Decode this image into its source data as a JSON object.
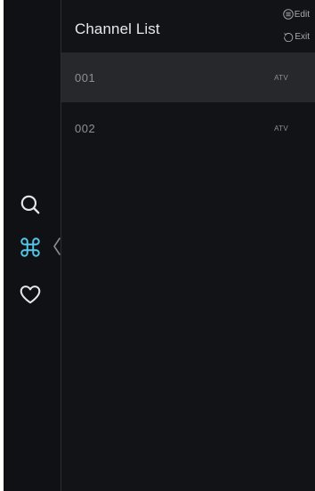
{
  "header": {
    "title": "Channel List",
    "edit_label": "Edit",
    "exit_label": "Exit"
  },
  "sidebar": {
    "items": [
      {
        "icon": "search-icon",
        "active": false
      },
      {
        "icon": "command-icon",
        "active": true
      },
      {
        "icon": "heart-icon",
        "active": false
      }
    ]
  },
  "channels": [
    {
      "number": "001",
      "type": "ATV",
      "selected": true
    },
    {
      "number": "002",
      "type": "ATV",
      "selected": false
    }
  ],
  "colors": {
    "background": "#121316",
    "selected_row": "#26282c",
    "accent": "#56c6e8",
    "text_primary": "#e8e8ea",
    "text_secondary": "#8e9095"
  }
}
